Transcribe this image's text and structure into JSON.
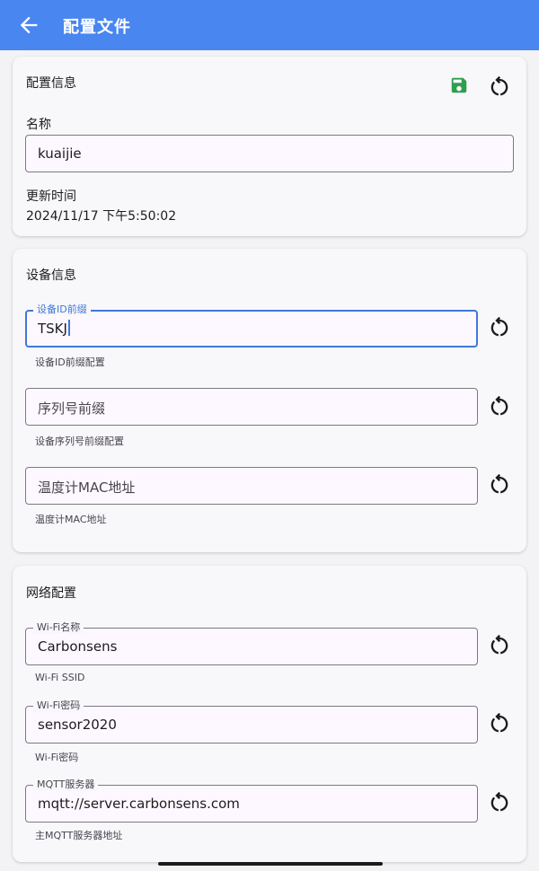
{
  "app_bar": {
    "title": "配置文件",
    "back_icon": "arrow-left-icon"
  },
  "config_card": {
    "title": "配置信息",
    "save_icon": "floppy-disk-icon",
    "save_color": "#2e9e4f",
    "reset_icon": "restore-icon",
    "name_label": "名称",
    "name_value": "kuaijie",
    "updated_label": "更新时间",
    "updated_value": "2024/11/17 下午5:50:02"
  },
  "device_card": {
    "title": "设备信息",
    "fields": [
      {
        "label": "设备ID前缀",
        "value": "TSKJ",
        "helper": "设备ID前缀配置",
        "focused": true
      },
      {
        "placeholder": "序列号前缀",
        "value": "",
        "helper": "设备序列号前缀配置"
      },
      {
        "placeholder": "温度计MAC地址",
        "value": "",
        "helper": "温度计MAC地址"
      }
    ]
  },
  "network_card": {
    "title": "网络配置",
    "fields": [
      {
        "label": "Wi-Fi名称",
        "value": "Carbonsens",
        "helper": "Wi-Fi SSID"
      },
      {
        "label": "Wi-Fi密码",
        "value": "sensor2020",
        "helper": "Wi-Fi密码"
      },
      {
        "label": "MQTT服务器",
        "value": "mqtt://server.carbonsens.com",
        "helper": "主MQTT服务器地址"
      }
    ]
  },
  "colors": {
    "app_bar": "#4a86f0",
    "focus": "#3f78d8",
    "background": "#f3f2f5"
  }
}
